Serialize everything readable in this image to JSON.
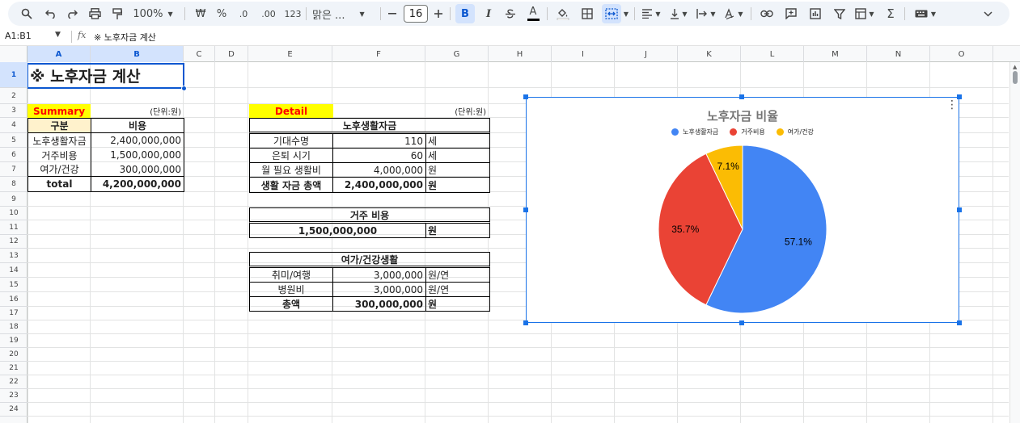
{
  "toolbar": {
    "zoom": "100%",
    "currency": "₩",
    "percent": "%",
    "dec_decrease": ".0",
    "dec_increase": ".00",
    "number_format": "123",
    "font_name": "맑은 ...",
    "font_size": "16",
    "bold": "B",
    "italic": "I",
    "text_color": "A"
  },
  "formula_bar": {
    "name_box": "A1:B1",
    "fx": "fx",
    "content": "※ 노후자금 계산"
  },
  "columns": [
    "A",
    "B",
    "C",
    "D",
    "E",
    "F",
    "G",
    "H",
    "I",
    "J",
    "K",
    "L",
    "M",
    "N",
    "O"
  ],
  "rows": [
    "1",
    "2",
    "3",
    "4",
    "5",
    "6",
    "7",
    "8",
    "9",
    "10",
    "11",
    "12",
    "13",
    "14",
    "15",
    "16",
    "17",
    "18",
    "19",
    "20",
    "21",
    "22",
    "23",
    "24"
  ],
  "sheet": {
    "title": "※ 노후자금 계산",
    "summary": {
      "label": "Summary",
      "unit": "(단위:원)",
      "header": [
        "구분",
        "비용"
      ],
      "rows": [
        [
          "노후생활자금",
          "2,400,000,000"
        ],
        [
          "거주비용",
          "1,500,000,000"
        ],
        [
          "여가/건강",
          "300,000,000"
        ]
      ],
      "total": [
        "total",
        "4,200,000,000"
      ]
    },
    "detail": {
      "label": "Detail",
      "unit": "(단위:원)",
      "living": {
        "header": "노후생활자금",
        "rows": [
          [
            "기대수명",
            "110",
            "세"
          ],
          [
            "은퇴 시기",
            "60",
            "세"
          ],
          [
            "월 필요 생활비",
            "4,000,000",
            "원"
          ]
        ],
        "total": [
          "생활 자금 총액",
          "2,400,000,000",
          "원"
        ]
      },
      "housing": {
        "header": "거주 비용",
        "value": "1,500,000,000",
        "unit": "원"
      },
      "leisure": {
        "header": "여가/건강생활",
        "rows": [
          [
            "취미/여행",
            "3,000,000",
            "원/연"
          ],
          [
            "병원비",
            "3,000,000",
            "원/연"
          ]
        ],
        "total": [
          "총액",
          "300,000,000",
          "원"
        ]
      }
    }
  },
  "chart_data": {
    "type": "pie",
    "title": "노후자금 비율",
    "categories": [
      "노후생활자금",
      "거주비용",
      "여가/건강"
    ],
    "values": [
      2400000000,
      1500000000,
      300000000
    ],
    "labels": [
      "57.1%",
      "35.7%",
      "7.1%"
    ],
    "colors": [
      "#4285f4",
      "#ea4335",
      "#fbbc04"
    ],
    "legend": "top"
  }
}
